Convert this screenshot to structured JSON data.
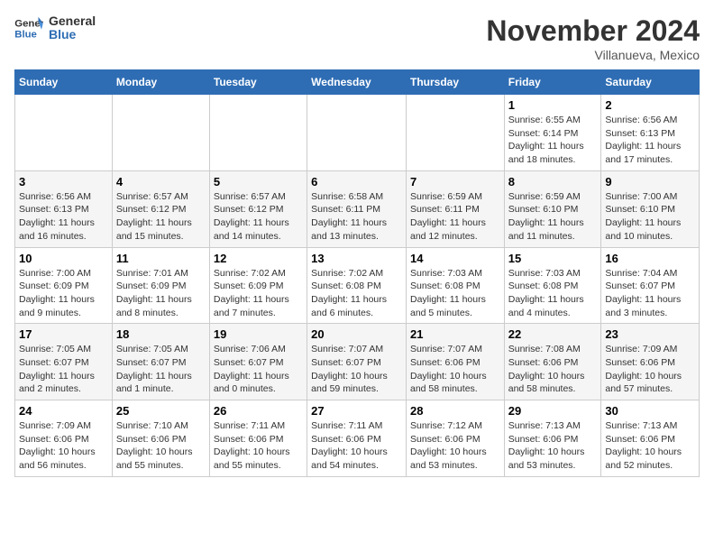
{
  "header": {
    "logo": {
      "general": "General",
      "blue": "Blue"
    },
    "month_title": "November 2024",
    "location": "Villanueva, Mexico"
  },
  "days_of_week": [
    "Sunday",
    "Monday",
    "Tuesday",
    "Wednesday",
    "Thursday",
    "Friday",
    "Saturday"
  ],
  "weeks": [
    [
      {
        "day": "",
        "info": ""
      },
      {
        "day": "",
        "info": ""
      },
      {
        "day": "",
        "info": ""
      },
      {
        "day": "",
        "info": ""
      },
      {
        "day": "",
        "info": ""
      },
      {
        "day": "1",
        "info": "Sunrise: 6:55 AM\nSunset: 6:14 PM\nDaylight: 11 hours and 18 minutes."
      },
      {
        "day": "2",
        "info": "Sunrise: 6:56 AM\nSunset: 6:13 PM\nDaylight: 11 hours and 17 minutes."
      }
    ],
    [
      {
        "day": "3",
        "info": "Sunrise: 6:56 AM\nSunset: 6:13 PM\nDaylight: 11 hours and 16 minutes."
      },
      {
        "day": "4",
        "info": "Sunrise: 6:57 AM\nSunset: 6:12 PM\nDaylight: 11 hours and 15 minutes."
      },
      {
        "day": "5",
        "info": "Sunrise: 6:57 AM\nSunset: 6:12 PM\nDaylight: 11 hours and 14 minutes."
      },
      {
        "day": "6",
        "info": "Sunrise: 6:58 AM\nSunset: 6:11 PM\nDaylight: 11 hours and 13 minutes."
      },
      {
        "day": "7",
        "info": "Sunrise: 6:59 AM\nSunset: 6:11 PM\nDaylight: 11 hours and 12 minutes."
      },
      {
        "day": "8",
        "info": "Sunrise: 6:59 AM\nSunset: 6:10 PM\nDaylight: 11 hours and 11 minutes."
      },
      {
        "day": "9",
        "info": "Sunrise: 7:00 AM\nSunset: 6:10 PM\nDaylight: 11 hours and 10 minutes."
      }
    ],
    [
      {
        "day": "10",
        "info": "Sunrise: 7:00 AM\nSunset: 6:09 PM\nDaylight: 11 hours and 9 minutes."
      },
      {
        "day": "11",
        "info": "Sunrise: 7:01 AM\nSunset: 6:09 PM\nDaylight: 11 hours and 8 minutes."
      },
      {
        "day": "12",
        "info": "Sunrise: 7:02 AM\nSunset: 6:09 PM\nDaylight: 11 hours and 7 minutes."
      },
      {
        "day": "13",
        "info": "Sunrise: 7:02 AM\nSunset: 6:08 PM\nDaylight: 11 hours and 6 minutes."
      },
      {
        "day": "14",
        "info": "Sunrise: 7:03 AM\nSunset: 6:08 PM\nDaylight: 11 hours and 5 minutes."
      },
      {
        "day": "15",
        "info": "Sunrise: 7:03 AM\nSunset: 6:08 PM\nDaylight: 11 hours and 4 minutes."
      },
      {
        "day": "16",
        "info": "Sunrise: 7:04 AM\nSunset: 6:07 PM\nDaylight: 11 hours and 3 minutes."
      }
    ],
    [
      {
        "day": "17",
        "info": "Sunrise: 7:05 AM\nSunset: 6:07 PM\nDaylight: 11 hours and 2 minutes."
      },
      {
        "day": "18",
        "info": "Sunrise: 7:05 AM\nSunset: 6:07 PM\nDaylight: 11 hours and 1 minute."
      },
      {
        "day": "19",
        "info": "Sunrise: 7:06 AM\nSunset: 6:07 PM\nDaylight: 11 hours and 0 minutes."
      },
      {
        "day": "20",
        "info": "Sunrise: 7:07 AM\nSunset: 6:07 PM\nDaylight: 10 hours and 59 minutes."
      },
      {
        "day": "21",
        "info": "Sunrise: 7:07 AM\nSunset: 6:06 PM\nDaylight: 10 hours and 58 minutes."
      },
      {
        "day": "22",
        "info": "Sunrise: 7:08 AM\nSunset: 6:06 PM\nDaylight: 10 hours and 58 minutes."
      },
      {
        "day": "23",
        "info": "Sunrise: 7:09 AM\nSunset: 6:06 PM\nDaylight: 10 hours and 57 minutes."
      }
    ],
    [
      {
        "day": "24",
        "info": "Sunrise: 7:09 AM\nSunset: 6:06 PM\nDaylight: 10 hours and 56 minutes."
      },
      {
        "day": "25",
        "info": "Sunrise: 7:10 AM\nSunset: 6:06 PM\nDaylight: 10 hours and 55 minutes."
      },
      {
        "day": "26",
        "info": "Sunrise: 7:11 AM\nSunset: 6:06 PM\nDaylight: 10 hours and 55 minutes."
      },
      {
        "day": "27",
        "info": "Sunrise: 7:11 AM\nSunset: 6:06 PM\nDaylight: 10 hours and 54 minutes."
      },
      {
        "day": "28",
        "info": "Sunrise: 7:12 AM\nSunset: 6:06 PM\nDaylight: 10 hours and 53 minutes."
      },
      {
        "day": "29",
        "info": "Sunrise: 7:13 AM\nSunset: 6:06 PM\nDaylight: 10 hours and 53 minutes."
      },
      {
        "day": "30",
        "info": "Sunrise: 7:13 AM\nSunset: 6:06 PM\nDaylight: 10 hours and 52 minutes."
      }
    ]
  ]
}
